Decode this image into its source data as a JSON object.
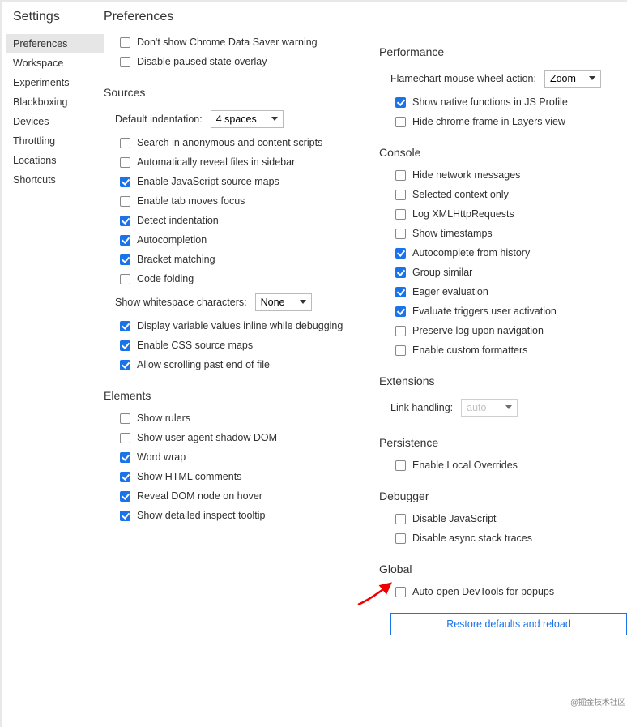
{
  "sidebar": {
    "title": "Settings",
    "items": [
      "Preferences",
      "Workspace",
      "Experiments",
      "Blackboxing",
      "Devices",
      "Throttling",
      "Locations",
      "Shortcuts"
    ],
    "activeIndex": 0
  },
  "page": {
    "title": "Preferences"
  },
  "left": {
    "appearance_checks": [
      {
        "label": "Don't show Chrome Data Saver warning",
        "checked": false
      },
      {
        "label": "Disable paused state overlay",
        "checked": false
      }
    ],
    "sources": {
      "title": "Sources",
      "indent_label": "Default indentation:",
      "indent_value": "4 spaces",
      "checks": [
        {
          "label": "Search in anonymous and content scripts",
          "checked": false
        },
        {
          "label": "Automatically reveal files in sidebar",
          "checked": false
        },
        {
          "label": "Enable JavaScript source maps",
          "checked": true
        },
        {
          "label": "Enable tab moves focus",
          "checked": false
        },
        {
          "label": "Detect indentation",
          "checked": true
        },
        {
          "label": "Autocompletion",
          "checked": true
        },
        {
          "label": "Bracket matching",
          "checked": true
        },
        {
          "label": "Code folding",
          "checked": false
        }
      ],
      "whitespace_label": "Show whitespace characters:",
      "whitespace_value": "None",
      "checks2": [
        {
          "label": "Display variable values inline while debugging",
          "checked": true
        },
        {
          "label": "Enable CSS source maps",
          "checked": true
        },
        {
          "label": "Allow scrolling past end of file",
          "checked": true
        }
      ]
    },
    "elements": {
      "title": "Elements",
      "checks": [
        {
          "label": "Show rulers",
          "checked": false
        },
        {
          "label": "Show user agent shadow DOM",
          "checked": false
        },
        {
          "label": "Word wrap",
          "checked": true
        },
        {
          "label": "Show HTML comments",
          "checked": true
        },
        {
          "label": "Reveal DOM node on hover",
          "checked": true
        },
        {
          "label": "Show detailed inspect tooltip",
          "checked": true
        }
      ]
    }
  },
  "right": {
    "performance": {
      "title": "Performance",
      "wheel_label": "Flamechart mouse wheel action:",
      "wheel_value": "Zoom",
      "checks": [
        {
          "label": "Show native functions in JS Profile",
          "checked": true
        },
        {
          "label": "Hide chrome frame in Layers view",
          "checked": false
        }
      ]
    },
    "console": {
      "title": "Console",
      "checks": [
        {
          "label": "Hide network messages",
          "checked": false
        },
        {
          "label": "Selected context only",
          "checked": false
        },
        {
          "label": "Log XMLHttpRequests",
          "checked": false
        },
        {
          "label": "Show timestamps",
          "checked": false
        },
        {
          "label": "Autocomplete from history",
          "checked": true
        },
        {
          "label": "Group similar",
          "checked": true
        },
        {
          "label": "Eager evaluation",
          "checked": true
        },
        {
          "label": "Evaluate triggers user activation",
          "checked": true
        },
        {
          "label": "Preserve log upon navigation",
          "checked": false
        },
        {
          "label": "Enable custom formatters",
          "checked": false
        }
      ]
    },
    "extensions": {
      "title": "Extensions",
      "link_label": "Link handling:",
      "link_value": "auto"
    },
    "persistence": {
      "title": "Persistence",
      "checks": [
        {
          "label": "Enable Local Overrides",
          "checked": false
        }
      ]
    },
    "debugger": {
      "title": "Debugger",
      "checks": [
        {
          "label": "Disable JavaScript",
          "checked": false
        },
        {
          "label": "Disable async stack traces",
          "checked": false
        }
      ]
    },
    "global": {
      "title": "Global",
      "checks": [
        {
          "label": "Auto-open DevTools for popups",
          "checked": false
        }
      ],
      "restore": "Restore defaults and reload"
    }
  },
  "watermark": "@掘金技术社区"
}
